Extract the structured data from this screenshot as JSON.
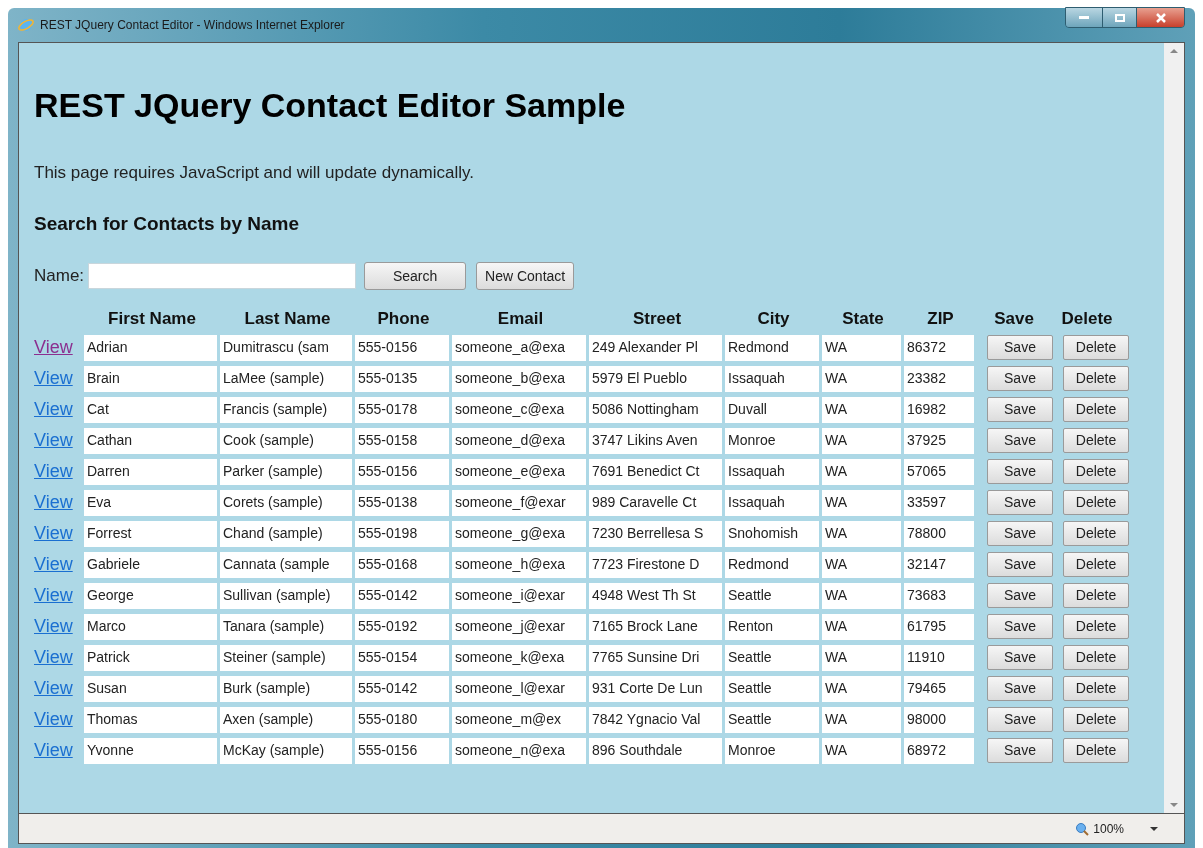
{
  "window": {
    "title": "REST JQuery Contact Editor - Windows Internet Explorer"
  },
  "page": {
    "heading": "REST JQuery Contact Editor Sample",
    "intro": "This page requires JavaScript and will update dynamically.",
    "search_heading": "Search for Contacts by Name",
    "name_label": "Name:",
    "search_button": "Search",
    "new_contact_button": "New Contact"
  },
  "table": {
    "columns": [
      "First Name",
      "Last Name",
      "Phone",
      "Email",
      "Street",
      "City",
      "State",
      "ZIP",
      "Save",
      "Delete"
    ],
    "rows": [
      {
        "link": "View",
        "visited": true,
        "first_name": "Adrian",
        "last_name": "Dumitrascu (sam",
        "phone": "555-0156",
        "email": "someone_a@exa",
        "street": "249 Alexander Pl",
        "city": "Redmond",
        "state": "WA",
        "zip": "86372",
        "save": "Save",
        "delete": "Delete"
      },
      {
        "link": "View",
        "visited": false,
        "first_name": "Brain",
        "last_name": "LaMee (sample)",
        "phone": "555-0135",
        "email": "someone_b@exa",
        "street": "5979 El Pueblo",
        "city": "Issaquah",
        "state": "WA",
        "zip": "23382",
        "save": "Save",
        "delete": "Delete"
      },
      {
        "link": "View",
        "visited": false,
        "first_name": "Cat",
        "last_name": "Francis (sample)",
        "phone": "555-0178",
        "email": "someone_c@exa",
        "street": "5086 Nottingham",
        "city": "Duvall",
        "state": "WA",
        "zip": "16982",
        "save": "Save",
        "delete": "Delete"
      },
      {
        "link": "View",
        "visited": false,
        "first_name": "Cathan",
        "last_name": "Cook (sample)",
        "phone": "555-0158",
        "email": "someone_d@exa",
        "street": "3747 Likins Aven",
        "city": "Monroe",
        "state": "WA",
        "zip": "37925",
        "save": "Save",
        "delete": "Delete"
      },
      {
        "link": "View",
        "visited": false,
        "first_name": "Darren",
        "last_name": "Parker (sample)",
        "phone": "555-0156",
        "email": "someone_e@exa",
        "street": "7691 Benedict Ct",
        "city": "Issaquah",
        "state": "WA",
        "zip": "57065",
        "save": "Save",
        "delete": "Delete"
      },
      {
        "link": "View",
        "visited": false,
        "first_name": "Eva",
        "last_name": "Corets (sample)",
        "phone": "555-0138",
        "email": "someone_f@exar",
        "street": "989 Caravelle Ct",
        "city": "Issaquah",
        "state": "WA",
        "zip": "33597",
        "save": "Save",
        "delete": "Delete"
      },
      {
        "link": "View",
        "visited": false,
        "first_name": "Forrest",
        "last_name": "Chand (sample)",
        "phone": "555-0198",
        "email": "someone_g@exa",
        "street": "7230 Berrellesa S",
        "city": "Snohomish",
        "state": "WA",
        "zip": "78800",
        "save": "Save",
        "delete": "Delete"
      },
      {
        "link": "View",
        "visited": false,
        "first_name": "Gabriele",
        "last_name": "Cannata (sample",
        "phone": "555-0168",
        "email": "someone_h@exa",
        "street": "7723 Firestone D",
        "city": "Redmond",
        "state": "WA",
        "zip": "32147",
        "save": "Save",
        "delete": "Delete"
      },
      {
        "link": "View",
        "visited": false,
        "first_name": "George",
        "last_name": "Sullivan (sample)",
        "phone": "555-0142",
        "email": "someone_i@exar",
        "street": "4948 West Th St",
        "city": "Seattle",
        "state": "WA",
        "zip": "73683",
        "save": "Save",
        "delete": "Delete"
      },
      {
        "link": "View",
        "visited": false,
        "first_name": "Marco",
        "last_name": "Tanara (sample)",
        "phone": "555-0192",
        "email": "someone_j@exar",
        "street": "7165 Brock Lane",
        "city": "Renton",
        "state": "WA",
        "zip": "61795",
        "save": "Save",
        "delete": "Delete"
      },
      {
        "link": "View",
        "visited": false,
        "first_name": "Patrick",
        "last_name": "Steiner (sample)",
        "phone": "555-0154",
        "email": "someone_k@exa",
        "street": "7765 Sunsine Dri",
        "city": "Seattle",
        "state": "WA",
        "zip": "11910",
        "save": "Save",
        "delete": "Delete"
      },
      {
        "link": "View",
        "visited": false,
        "first_name": "Susan",
        "last_name": "Burk (sample)",
        "phone": "555-0142",
        "email": "someone_l@exar",
        "street": "931 Corte De Lun",
        "city": "Seattle",
        "state": "WA",
        "zip": "79465",
        "save": "Save",
        "delete": "Delete"
      },
      {
        "link": "View",
        "visited": false,
        "first_name": "Thomas",
        "last_name": "Axen (sample)",
        "phone": "555-0180",
        "email": "someone_m@ex",
        "street": "7842 Ygnacio Val",
        "city": "Seattle",
        "state": "WA",
        "zip": "98000",
        "save": "Save",
        "delete": "Delete"
      },
      {
        "link": "View",
        "visited": false,
        "first_name": "Yvonne",
        "last_name": "McKay (sample)",
        "phone": "555-0156",
        "email": "someone_n@exa",
        "street": "896 Southdale",
        "city": "Monroe",
        "state": "WA",
        "zip": "68972",
        "save": "Save",
        "delete": "Delete"
      }
    ]
  },
  "status_bar": {
    "zoom": "100%"
  }
}
